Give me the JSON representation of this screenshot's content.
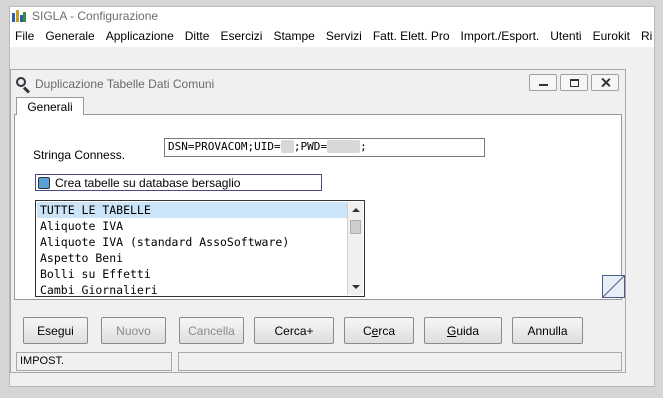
{
  "app": {
    "title": "SIGLA - Configurazione",
    "menu": [
      "File",
      "Generale",
      "Applicazione",
      "Ditte",
      "Esercizi",
      "Stampe",
      "Servizi",
      "Fatt. Elett. Pro",
      "Import./Esport.",
      "Utenti",
      "Eurokit",
      "Ri"
    ]
  },
  "dialog": {
    "title": "Duplicazione Tabelle Dati Comuni",
    "tab_label": "Generali",
    "conn_label": "Stringa Conness.",
    "conn_value_a": "DSN=PROVACOM;UID=",
    "conn_value_mask1": "sa",
    "conn_value_b": ";PWD=",
    "conn_value_mask2": "xxxxx",
    "conn_value_c": ";",
    "checkbox_label": "Crea tabelle su database bersaglio",
    "checkbox_color": "#5aa0d8",
    "selection_color": "#cce4f7",
    "list_items": [
      "TUTTE LE TABELLE",
      "Aliquote IVA",
      "Aliquote IVA (standard AssoSoftware)",
      "Aspetto Beni",
      "Bolli su Effetti",
      "Cambi Giornalieri"
    ],
    "buttons": {
      "esegui": "Esegui",
      "nuovo": "Nuovo",
      "cancella": "Cancella",
      "cerca_plus": "Cerca+",
      "cerca_pre": "C",
      "cerca_u": "e",
      "cerca_post": "rca",
      "guida_u": "G",
      "guida_post": "uida",
      "annulla": "Annulla"
    },
    "status": {
      "cell1": "IMPOST.",
      "cell2": ""
    }
  }
}
